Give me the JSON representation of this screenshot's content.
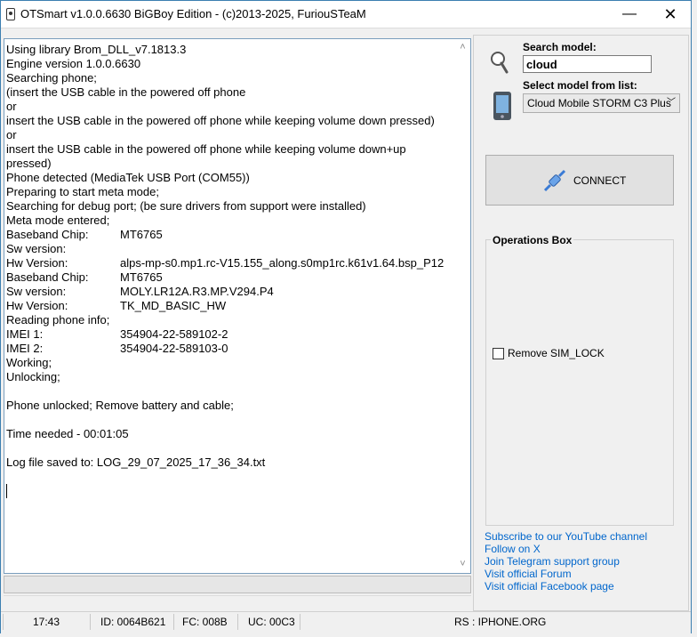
{
  "window": {
    "title": "OTSmart  v1.0.0.6630 BiGBoy Edition - (c)2013-2025, FuriouSTeaM",
    "minimize_glyph": "—",
    "close_glyph": "✕"
  },
  "log": {
    "lines": [
      {
        "text": "Using library Brom_DLL_v7.1813.3"
      },
      {
        "text": "Engine version 1.0.0.6630"
      },
      {
        "text": "Searching phone;"
      },
      {
        "text": "(insert the USB cable in the powered off phone"
      },
      {
        "text": "or"
      },
      {
        "text": "insert the USB cable in the powered off phone while keeping volume down pressed)"
      },
      {
        "text": "or"
      },
      {
        "text": "insert the USB cable in the powered off phone while keeping volume down+up"
      },
      {
        "text": "pressed)"
      },
      {
        "text": "Phone detected (MediaTek USB Port (COM55))"
      },
      {
        "text": "Preparing to start meta mode;"
      },
      {
        "text": "Searching for debug port; (be sure drivers from support were installed)"
      },
      {
        "text": "Meta mode entered;"
      },
      {
        "label": "Baseband Chip:",
        "value": "MT6765"
      },
      {
        "label": "Sw version:",
        "value": ""
      },
      {
        "label": "Hw Version:",
        "value": "alps-mp-s0.mp1.rc-V15.155_along.s0mp1rc.k61v1.64.bsp_P12"
      },
      {
        "label": "Baseband Chip:",
        "value": "MT6765"
      },
      {
        "label": "Sw version:",
        "value": "MOLY.LR12A.R3.MP.V294.P4"
      },
      {
        "label": "Hw Version:",
        "value": "TK_MD_BASIC_HW"
      },
      {
        "text": "Reading phone info;"
      },
      {
        "label": "IMEI 1:",
        "value": "354904-22-589102-2"
      },
      {
        "label": "IMEI 2:",
        "value": "354904-22-589103-0"
      },
      {
        "text": "Working;"
      },
      {
        "text": "Unlocking;"
      },
      {
        "text": ""
      },
      {
        "text": "Phone unlocked; Remove battery and cable;"
      },
      {
        "text": ""
      },
      {
        "text": "Time needed - 00:01:05"
      },
      {
        "text": ""
      },
      {
        "text": "Log file saved to: LOG_29_07_2025_17_36_34.txt"
      }
    ]
  },
  "search": {
    "label": "Search model:",
    "value": "cloud"
  },
  "model": {
    "label": "Select model from list:",
    "selected": "Cloud Mobile STORM C3 Plus"
  },
  "connect": {
    "label": "CONNECT"
  },
  "operations": {
    "title": "Operations Box",
    "remove_simlock_label": "Remove SIM_LOCK"
  },
  "links": [
    "Subscribe to our YouTube channel",
    "Follow on X",
    "Join Telegram support group",
    "Visit official Forum",
    "Visit official Facebook page"
  ],
  "status": {
    "time": "17:43",
    "id": "ID: 0064B621",
    "fc": "FC: 008B",
    "uc": "UC: 00C3",
    "rs": "RS : IPHONE.ORG"
  },
  "colors": {
    "accent": "#3c7fb1",
    "link": "#0066cc"
  }
}
